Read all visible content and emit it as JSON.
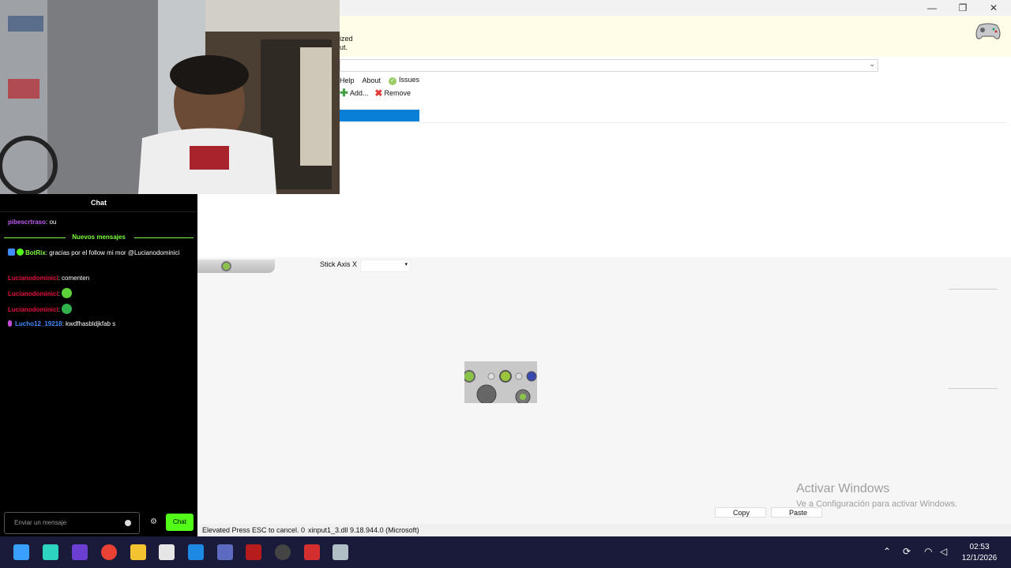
{
  "window": {
    "minimize_glyph": "—",
    "maximize_glyph": "❐",
    "close_glyph": "✕"
  },
  "banner": {
    "line1": "ized",
    "line2": "ut."
  },
  "menu": {
    "help": "Help",
    "about": "About",
    "issues": "Issues"
  },
  "toolbar": {
    "add": "Add...",
    "remove": "Remove"
  },
  "mapping": {
    "stick_axis_label": "Stick Axis X"
  },
  "watermark": {
    "title": "Activar Windows",
    "subtitle": "Ve a Configuración para activar Windows."
  },
  "buttons": {
    "copy": "Copy",
    "paste": "Paste"
  },
  "status": {
    "left": "Elevated Press ESC to cancel. 0",
    "dll": "xinput1_3.dll 9.18.944.0 (Microsoft)"
  },
  "chat": {
    "header": "Chat",
    "new_messages": "Nuevos mensajes",
    "input_placeholder": "Enviar un mensaje",
    "send_label": "Chat",
    "messages": [
      {
        "user": "pibescrtraso",
        "sep": ": ",
        "text": "ou",
        "color": "#c15cf5"
      },
      {
        "user": "BotRix",
        "sep": ": ",
        "text": "gracias por el follow mi mor @Lucianodominici",
        "color": "#7cff3c"
      },
      {
        "user": "Lucianodominici",
        "sep": ": ",
        "text": "comenten",
        "color": "#e3113e"
      },
      {
        "user": "Lucianodominici",
        "sep": ": ",
        "text": "",
        "color": "#e3113e"
      },
      {
        "user": "Lucianodominici",
        "sep": ": ",
        "text": "",
        "color": "#e3113e"
      },
      {
        "user": "Lucho12_19218",
        "sep": ": ",
        "text": "kwdfhasbldjkfab s",
        "color": "#3f8cff"
      }
    ]
  },
  "taskbar": {
    "time": "02:53",
    "date": "12/1/2026"
  },
  "colors": {
    "accent_green": "#53fc18",
    "selection_blue": "#0a7fd8",
    "taskbar_bg": "#1a1a3a"
  }
}
